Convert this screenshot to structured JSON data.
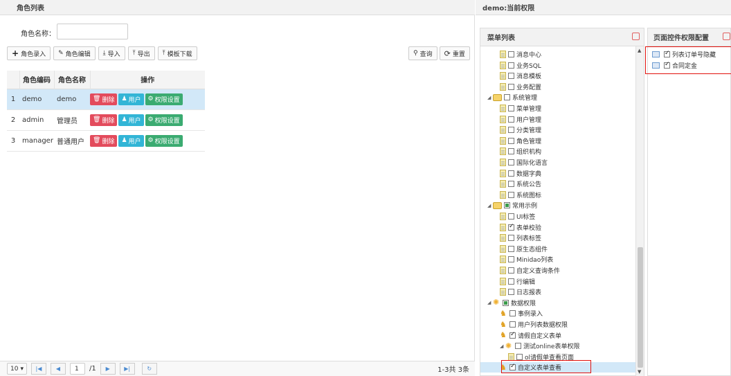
{
  "left": {
    "title": "角色列表",
    "search": {
      "label": "角色名称：",
      "value": ""
    },
    "toolbar": {
      "add": "角色录入",
      "edit": "角色编辑",
      "import": "导入",
      "export": "导出",
      "template": "模板下载",
      "query": "查询",
      "reset": "重置"
    },
    "table": {
      "headers": [
        "角色编码",
        "角色名称",
        "操作"
      ],
      "rows": [
        {
          "n": "1",
          "code": "demo",
          "name": "demo"
        },
        {
          "n": "2",
          "code": "admin",
          "name": "管理员"
        },
        {
          "n": "3",
          "code": "manager",
          "name": "普通用户"
        }
      ],
      "action_delete": "删除",
      "action_user": "用户",
      "action_perm": "权限设置"
    },
    "pager": {
      "size": "10",
      "page": "1",
      "total_pages": "/1",
      "summary": "1-3共 3条"
    }
  },
  "right": {
    "title": "demo:当前权限",
    "menu_title": "菜单列表",
    "ctrl_title": "页面控件权限配置",
    "ctrl_items": [
      "列表订单号隐藏",
      "合同定金"
    ],
    "tree": [
      {
        "label": "消息中心",
        "icon": "doc",
        "level": 2,
        "state": "none"
      },
      {
        "label": "业务SQL",
        "icon": "doc",
        "level": 2,
        "state": "none"
      },
      {
        "label": "消息模板",
        "icon": "doc",
        "level": 2,
        "state": "none"
      },
      {
        "label": "业务配置",
        "icon": "doc",
        "level": 2,
        "state": "none"
      },
      {
        "label": "系统管理",
        "icon": "folder",
        "level": 1,
        "state": "none"
      },
      {
        "label": "菜单管理",
        "icon": "doc",
        "level": 2,
        "state": "none"
      },
      {
        "label": "用户管理",
        "icon": "doc",
        "level": 2,
        "state": "none"
      },
      {
        "label": "分类管理",
        "icon": "doc",
        "level": 2,
        "state": "none"
      },
      {
        "label": "角色管理",
        "icon": "doc",
        "level": 2,
        "state": "none"
      },
      {
        "label": "组织机构",
        "icon": "doc",
        "level": 2,
        "state": "none"
      },
      {
        "label": "国际化语言",
        "icon": "doc",
        "level": 2,
        "state": "none"
      },
      {
        "label": "数据字典",
        "icon": "doc",
        "level": 2,
        "state": "none"
      },
      {
        "label": "系统公告",
        "icon": "doc",
        "level": 2,
        "state": "none"
      },
      {
        "label": "系统图标",
        "icon": "doc",
        "level": 2,
        "state": "none"
      },
      {
        "label": "常用示例",
        "icon": "folder",
        "level": 1,
        "state": "partial"
      },
      {
        "label": "UI标签",
        "icon": "doc",
        "level": 2,
        "state": "none"
      },
      {
        "label": "表单校验",
        "icon": "doc",
        "level": 2,
        "state": "checked"
      },
      {
        "label": "列表标签",
        "icon": "doc",
        "level": 2,
        "state": "none"
      },
      {
        "label": "原生态组件",
        "icon": "doc",
        "level": 2,
        "state": "none"
      },
      {
        "label": "Minidao列表",
        "icon": "doc",
        "level": 2,
        "state": "none"
      },
      {
        "label": "自定义查询条件",
        "icon": "doc",
        "level": 2,
        "state": "none"
      },
      {
        "label": "行编辑",
        "icon": "doc",
        "level": 2,
        "state": "none"
      },
      {
        "label": "日志报表",
        "icon": "doc",
        "level": 2,
        "state": "none"
      },
      {
        "label": "数据权限",
        "icon": "gear",
        "level": 1,
        "state": "partial"
      },
      {
        "label": "事例录入",
        "icon": "user",
        "level": 2,
        "state": "none"
      },
      {
        "label": "用户列表数据权限",
        "icon": "user",
        "level": 2,
        "state": "none"
      },
      {
        "label": "请假自定义表单",
        "icon": "user",
        "level": 2,
        "state": "checked"
      },
      {
        "label": "测试online表单权限",
        "icon": "gear",
        "level": 2,
        "state": "none"
      },
      {
        "label": "ol请假单查看页面",
        "icon": "doc",
        "level": 3,
        "state": "none"
      },
      {
        "label": "自定义表单查看",
        "icon": "user",
        "level": 2,
        "state": "checked"
      }
    ],
    "colors": {
      "accent_red": "#e34b5c",
      "accent_cyan": "#32b5d6",
      "accent_green": "#3bab71",
      "highlight": "#e2100b"
    }
  }
}
